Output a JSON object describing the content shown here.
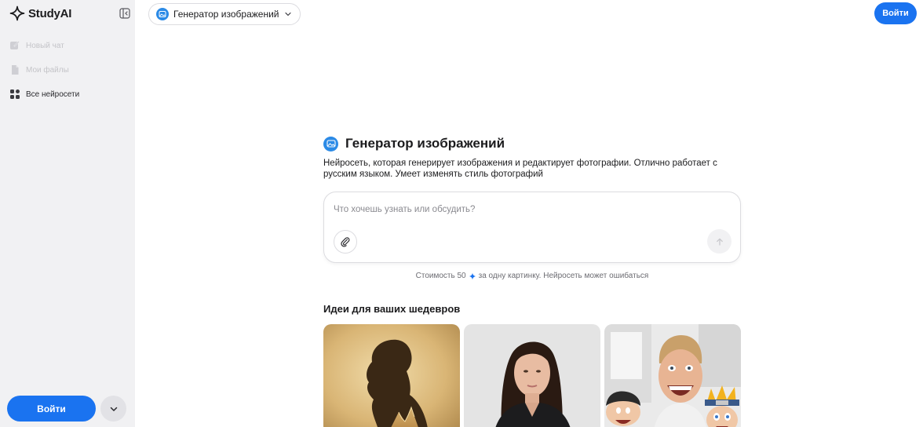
{
  "app": {
    "name": "StudyAI"
  },
  "sidebar": {
    "items": [
      {
        "label": "Новый чат",
        "icon": "pencil-square-icon",
        "state": "disabled"
      },
      {
        "label": "Мои файлы",
        "icon": "file-icon",
        "state": "disabled"
      },
      {
        "label": "Все нейросети",
        "icon": "grid-icon",
        "state": "active"
      }
    ],
    "login_label": "Войти"
  },
  "header": {
    "model_label": "Генератор изображений",
    "login_label": "Войти"
  },
  "main": {
    "title": "Генератор изображений",
    "description": "Нейросеть, которая генерирует изображения и редактирует фотографии. Отлично работает с русским языком. Умеет изменять стиль фотографий",
    "prompt_placeholder": "Что хочешь узнать или обсудить?",
    "cost_prefix": "Стоимость 50",
    "cost_suffix": "за одну картинку. Нейросеть может ошибаться",
    "ideas_title": "Идеи для ваших шедевров",
    "ideas": [
      {
        "subject": "silhouette-with-mountains"
      },
      {
        "subject": "woman-portrait"
      },
      {
        "subject": "man-with-cartoon-characters"
      }
    ]
  },
  "colors": {
    "accent": "#1a73f0",
    "sidebar_bg": "#f1f1f3",
    "icon_blue": "#2b8ae6"
  }
}
